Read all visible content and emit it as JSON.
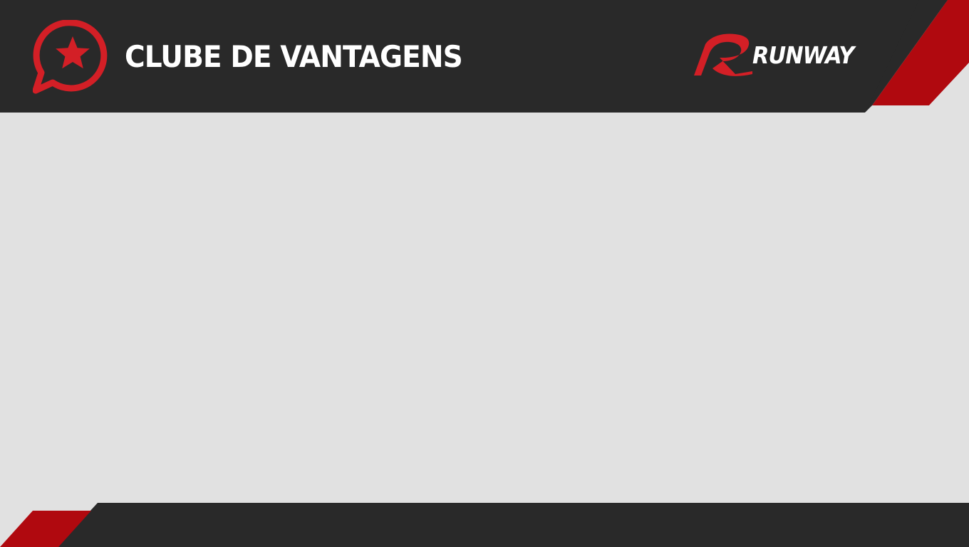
{
  "header": {
    "title": "CLUBE DE VANTAGENS",
    "icon": "star-chat-bubble-icon",
    "brand": {
      "wordmark": "RUNWAY",
      "icon": "runway-r-logo"
    }
  },
  "colors": {
    "dark": "#292929",
    "accent_red": "#d31f26",
    "stripe_red": "#b0090f",
    "background": "#e1e1e1",
    "text": "#ffffff"
  }
}
